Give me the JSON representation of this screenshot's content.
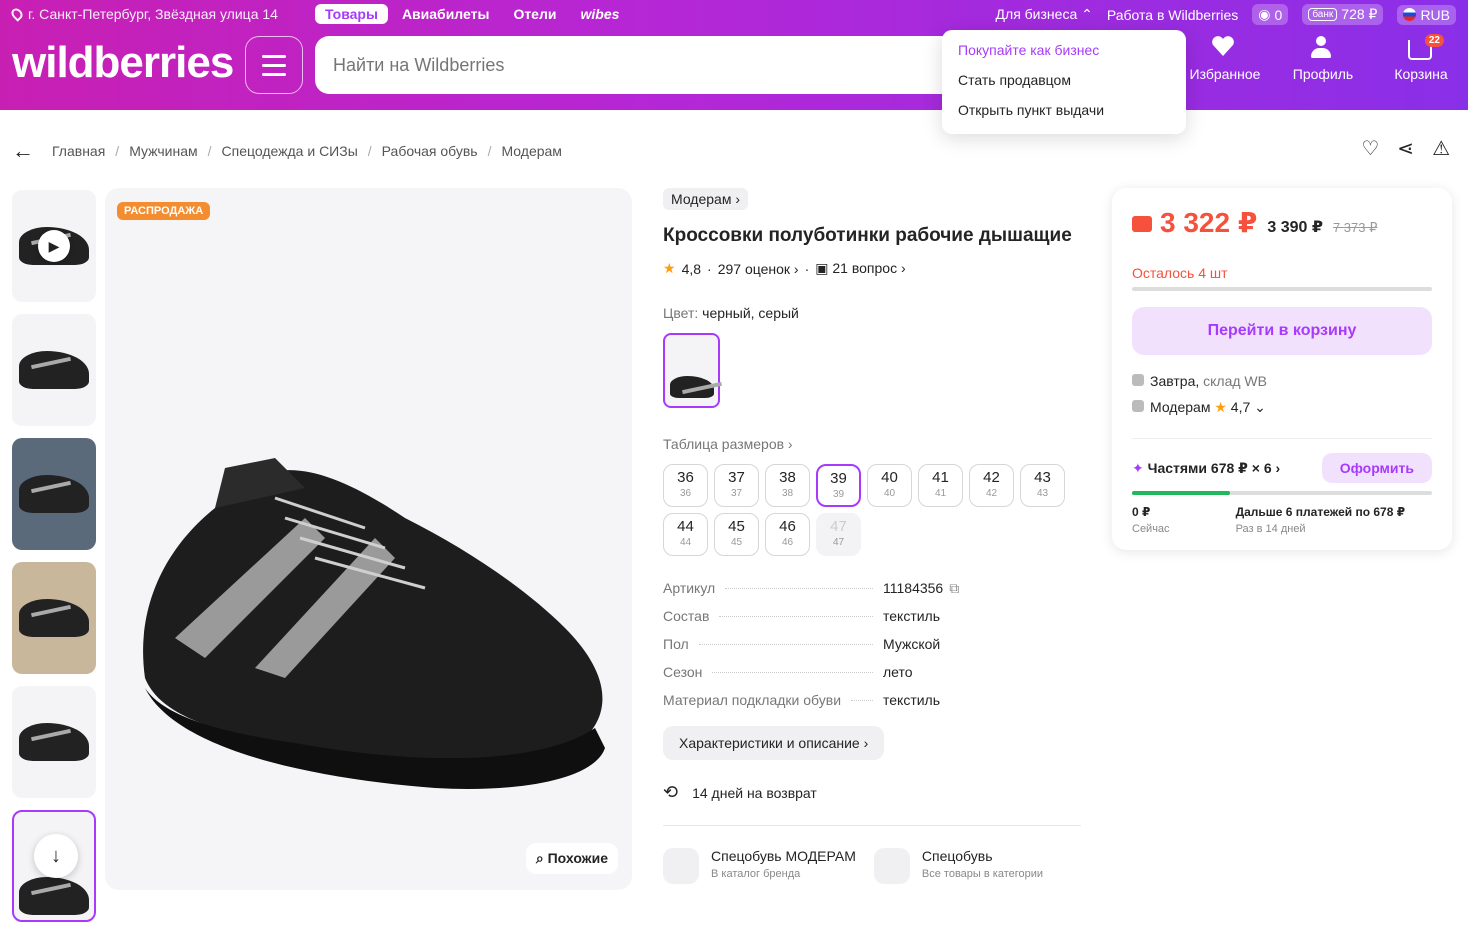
{
  "header": {
    "location": "г. Санкт-Петербург, Звёздная улица 14",
    "tabs": [
      "Товары",
      "Авиабилеты",
      "Отели",
      "wibes"
    ],
    "business": "Для бизнеса",
    "work": "Работа в Wildberries",
    "points": "0",
    "bank_label": "банк",
    "bank_amount": "728 ₽",
    "currency": "RUB",
    "logo": "wildberries",
    "search_placeholder": "Найти на Wildberries",
    "nav": {
      "favorites": "Избранное",
      "profile": "Профиль",
      "cart": "Корзина",
      "cart_count": "22"
    },
    "accent": "#a73afd"
  },
  "business_menu": [
    "Покупайте как бизнес",
    "Стать продавцом",
    "Открыть пункт выдачи"
  ],
  "breadcrumbs": [
    "Главная",
    "Мужчинам",
    "Спецодежда и СИЗы",
    "Рабочая обувь",
    "Модерам"
  ],
  "gallery": {
    "badge": "РАСПРОДАЖА",
    "similar": "Похожие"
  },
  "product": {
    "brand": "Модерам",
    "title": "Кроссовки полуботинки рабочие дышащие",
    "rating": "4,8",
    "reviews": "297 оценок",
    "questions": "21 вопрос",
    "color_label": "Цвет:",
    "color_value": "черный, серый",
    "size_table": "Таблица размеров",
    "sizes": [
      {
        "ru": "36",
        "eu": "36"
      },
      {
        "ru": "37",
        "eu": "37"
      },
      {
        "ru": "38",
        "eu": "38"
      },
      {
        "ru": "39",
        "eu": "39"
      },
      {
        "ru": "40",
        "eu": "40"
      },
      {
        "ru": "41",
        "eu": "41"
      },
      {
        "ru": "42",
        "eu": "42"
      },
      {
        "ru": "43",
        "eu": "43"
      },
      {
        "ru": "44",
        "eu": "44"
      },
      {
        "ru": "45",
        "eu": "45"
      },
      {
        "ru": "46",
        "eu": "46"
      },
      {
        "ru": "47",
        "eu": "47"
      }
    ],
    "selected_size": "39",
    "unavailable_size": "47",
    "specs": [
      {
        "k": "Артикул",
        "v": "11184356"
      },
      {
        "k": "Состав",
        "v": "текстиль"
      },
      {
        "k": "Пол",
        "v": "Мужской"
      },
      {
        "k": "Сезон",
        "v": "лето"
      },
      {
        "k": "Материал подкладки обуви",
        "v": "текстиль"
      }
    ],
    "characteristics_btn": "Характеристики и описание",
    "returns": "14 дней на возврат",
    "brand_link": {
      "title": "Спецобувь МОДЕРАМ",
      "sub": "В каталог бренда"
    },
    "category_link": {
      "title": "Спецобувь",
      "sub": "Все товары в категории"
    }
  },
  "price": {
    "now": "3 322 ₽",
    "mid": "3 390 ₽",
    "old": "7 373 ₽",
    "left": "Осталось 4 шт",
    "cart_btn": "Перейти в корзину",
    "delivery": "Завтра,",
    "warehouse": "склад WB",
    "seller": "Модерам",
    "seller_rating": "4,7",
    "installments": "Частями 678 ₽ × 6",
    "installments_btn": "Оформить",
    "pay_now_amount": "0 ₽",
    "pay_now_label": "Сейчас",
    "pay_later": "Дальше 6 платежей по 678 ₽",
    "pay_later_label": "Раз в 14 дней"
  }
}
